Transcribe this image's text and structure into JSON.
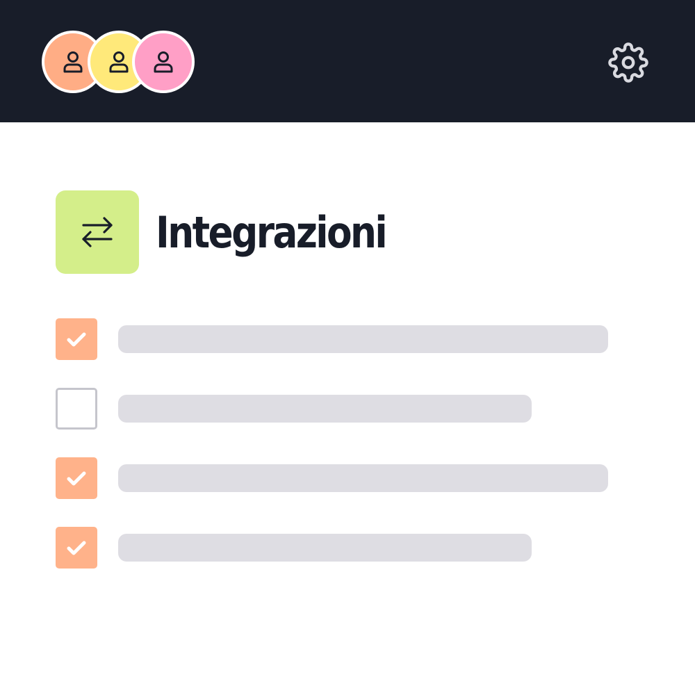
{
  "header": {
    "background": "#181d29",
    "avatars": [
      {
        "icon": "user-icon",
        "color": "#ffad85"
      },
      {
        "icon": "user-icon",
        "color": "#ffe97a"
      },
      {
        "icon": "user-icon",
        "color": "#ff9fc6"
      }
    ],
    "settings_icon": "gear-icon"
  },
  "section": {
    "icon": "arrows-swap-icon",
    "icon_background": "#d4ee8a",
    "title": "Integrazioni"
  },
  "checklist": {
    "accent": "#ffb28a",
    "items": [
      {
        "checked": true
      },
      {
        "checked": false
      },
      {
        "checked": true
      },
      {
        "checked": true
      }
    ]
  }
}
